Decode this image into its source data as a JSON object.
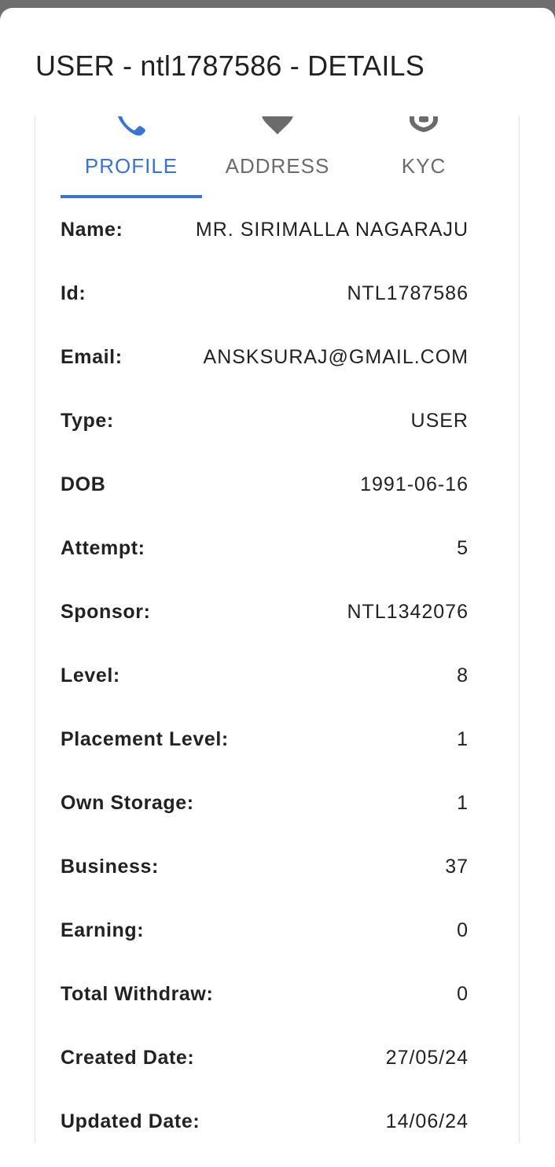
{
  "dialog": {
    "title": "USER - ntl1787586 - DETAILS"
  },
  "tabs": [
    {
      "label": "PROFILE",
      "icon": "phone-icon",
      "active": true
    },
    {
      "label": "ADDRESS",
      "icon": "location-pin-icon",
      "active": false
    },
    {
      "label": "KYC",
      "icon": "id-badge-icon",
      "active": false
    }
  ],
  "profile": {
    "rows": [
      {
        "label": "Name:",
        "value": "MR. SIRIMALLA NAGARAJU"
      },
      {
        "label": "Id:",
        "value": "NTL1787586"
      },
      {
        "label": "Email:",
        "value": "ANSKSURAJ@GMAIL.COM"
      },
      {
        "label": "Type:",
        "value": "USER"
      },
      {
        "label": "DOB",
        "value": "1991-06-16"
      },
      {
        "label": "Attempt:",
        "value": "5"
      },
      {
        "label": "Sponsor:",
        "value": "NTL1342076"
      },
      {
        "label": "Level:",
        "value": "8"
      },
      {
        "label": "Placement Level:",
        "value": "1"
      },
      {
        "label": "Own Storage:",
        "value": "1"
      },
      {
        "label": "Business:",
        "value": "37"
      },
      {
        "label": "Earning:",
        "value": "0"
      },
      {
        "label": "Total Withdraw:",
        "value": "0"
      },
      {
        "label": "Created Date:",
        "value": "27/05/24"
      },
      {
        "label": "Updated Date:",
        "value": "14/06/24"
      }
    ]
  },
  "colors": {
    "accent": "#3a74cf",
    "inactive_tab": "#6b6b6b",
    "text": "#222222",
    "overlay": "#6e6e6e"
  }
}
